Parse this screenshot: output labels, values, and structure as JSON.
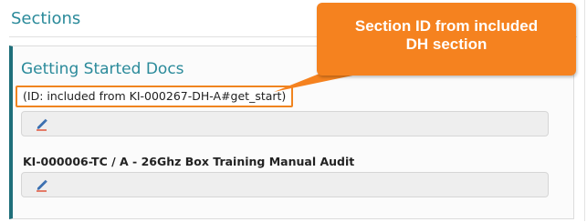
{
  "panel": {
    "title": "Sections"
  },
  "section": {
    "title": "Getting Started Docs",
    "id_text": "(ID: included from KI-000267-DH-A#get_start)",
    "item_title": "KI-000006-TC / A - 26Ghz Box Training Manual Audit"
  },
  "callout": {
    "line1": "Section ID from included",
    "line2": "DH section"
  },
  "icons": {
    "edit": "pencil-icon"
  },
  "colors": {
    "accent": "#2a8a9a",
    "callout": "#f5821f",
    "edit_icon": "#e04a2e",
    "card_border": "#1f6f7a"
  }
}
